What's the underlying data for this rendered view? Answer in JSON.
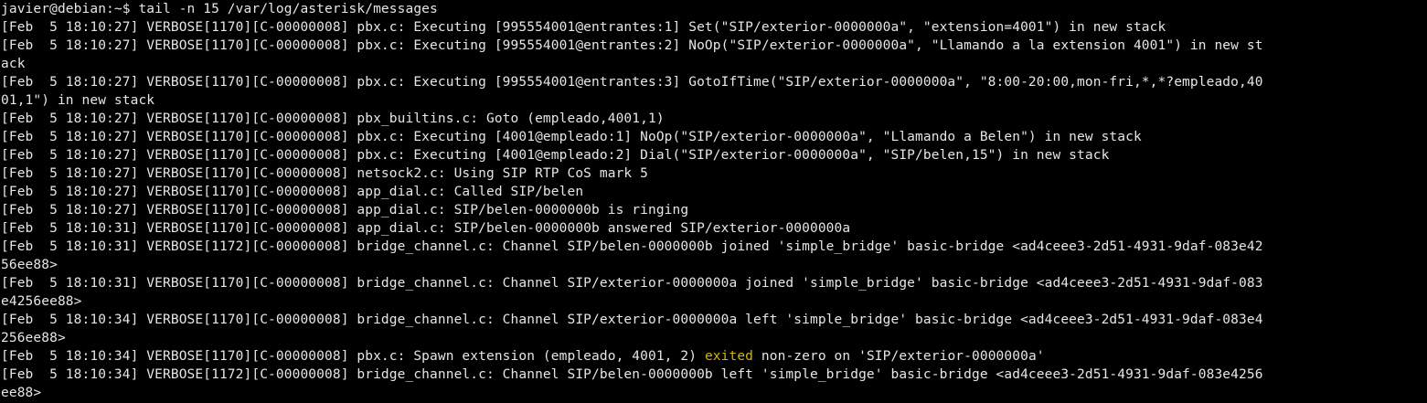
{
  "terminal": {
    "prompt": "javier@debian:~$ tail -n 15 /var/log/asterisk/messages",
    "lines": [
      "[Feb  5 18:10:27] VERBOSE[1170][C-00000008] pbx.c: Executing [995554001@entrantes:1] Set(\"SIP/exterior-0000000a\", \"extension=4001\") in new stack",
      "[Feb  5 18:10:27] VERBOSE[1170][C-00000008] pbx.c: Executing [995554001@entrantes:2] NoOp(\"SIP/exterior-0000000a\", \"Llamando a la extension 4001\") in new st",
      "ack",
      "[Feb  5 18:10:27] VERBOSE[1170][C-00000008] pbx.c: Executing [995554001@entrantes:3] GotoIfTime(\"SIP/exterior-0000000a\", \"8:00-20:00,mon-fri,*,*?empleado,40",
      "01,1\") in new stack",
      "[Feb  5 18:10:27] VERBOSE[1170][C-00000008] pbx_builtins.c: Goto (empleado,4001,1)",
      "[Feb  5 18:10:27] VERBOSE[1170][C-00000008] pbx.c: Executing [4001@empleado:1] NoOp(\"SIP/exterior-0000000a\", \"Llamando a Belen\") in new stack",
      "[Feb  5 18:10:27] VERBOSE[1170][C-00000008] pbx.c: Executing [4001@empleado:2] Dial(\"SIP/exterior-0000000a\", \"SIP/belen,15\") in new stack",
      "[Feb  5 18:10:27] VERBOSE[1170][C-00000008] netsock2.c: Using SIP RTP CoS mark 5",
      "[Feb  5 18:10:27] VERBOSE[1170][C-00000008] app_dial.c: Called SIP/belen",
      "[Feb  5 18:10:27] VERBOSE[1170][C-00000008] app_dial.c: SIP/belen-0000000b is ringing",
      "[Feb  5 18:10:31] VERBOSE[1170][C-00000008] app_dial.c: SIP/belen-0000000b answered SIP/exterior-0000000a",
      "[Feb  5 18:10:31] VERBOSE[1172][C-00000008] bridge_channel.c: Channel SIP/belen-0000000b joined 'simple_bridge' basic-bridge <ad4ceee3-2d51-4931-9daf-083e42",
      "56ee88>",
      "[Feb  5 18:10:31] VERBOSE[1170][C-00000008] bridge_channel.c: Channel SIP/exterior-0000000a joined 'simple_bridge' basic-bridge <ad4ceee3-2d51-4931-9daf-083",
      "e4256ee88>",
      "[Feb  5 18:10:34] VERBOSE[1170][C-00000008] bridge_channel.c: Channel SIP/exterior-0000000a left 'simple_bridge' basic-bridge <ad4ceee3-2d51-4931-9daf-083e4",
      "256ee88>"
    ],
    "spawn_line": {
      "before": "[Feb  5 18:10:34] VERBOSE[1170][C-00000008] pbx.c: Spawn extension (empleado, 4001, 2) ",
      "highlight": "exited",
      "after": " non-zero on 'SIP/exterior-0000000a'"
    },
    "tail_lines": [
      "[Feb  5 18:10:34] VERBOSE[1172][C-00000008] bridge_channel.c: Channel SIP/belen-0000000b left 'simple_bridge' basic-bridge <ad4ceee3-2d51-4931-9daf-083e4256",
      "ee88>"
    ],
    "colors": {
      "background": "#000000",
      "text": "#e6e6e6",
      "highlight": "#d6b400",
      "cursor": "#b3c400"
    }
  }
}
